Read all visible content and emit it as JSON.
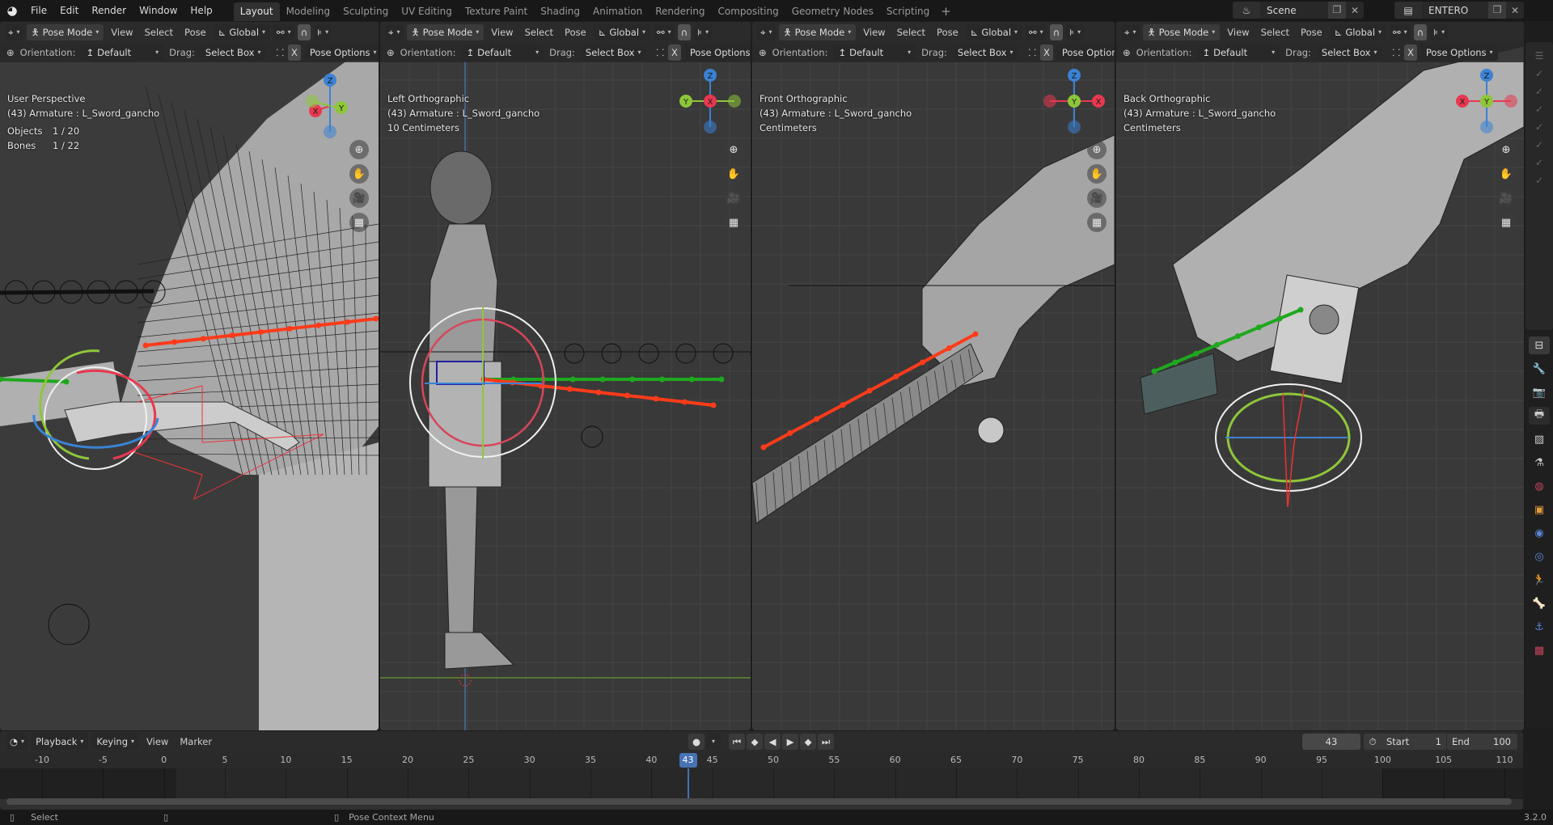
{
  "app": {
    "menu": [
      "File",
      "Edit",
      "Render",
      "Window",
      "Help"
    ],
    "workspaces": [
      "Layout",
      "Modeling",
      "Sculpting",
      "UV Editing",
      "Texture Paint",
      "Shading",
      "Animation",
      "Rendering",
      "Compositing",
      "Geometry Nodes",
      "Scripting"
    ],
    "active_workspace": "Layout",
    "add_workspace": "+",
    "scene": "Scene",
    "view_layer": "ENTERO",
    "version": "3.2.0"
  },
  "viewport_header": {
    "mode": "Pose Mode",
    "menus": [
      "View",
      "Select",
      "Pose"
    ],
    "transform_orientation": "Global",
    "orientation_label": "Orientation:",
    "orientation_value": "Default",
    "drag_label": "Drag:",
    "drag_value": "Select Box",
    "x_mirror": "X",
    "pose_options": "Pose Options"
  },
  "viewports": [
    {
      "view": "User Perspective",
      "object": "(43) Armature : L_Sword_gancho",
      "objects_label": "Objects",
      "objects_value": "1 / 20",
      "bones_label": "Bones",
      "bones_value": "1 / 22"
    },
    {
      "view": "Left Orthographic",
      "object": "(43) Armature : L_Sword_gancho",
      "scale": "10 Centimeters"
    },
    {
      "view": "Front Orthographic",
      "object": "(43) Armature : L_Sword_gancho",
      "scale": "Centimeters"
    },
    {
      "view": "Back Orthographic",
      "object": "(43) Armature : L_Sword_gancho",
      "scale": "Centimeters"
    }
  ],
  "gizmo_labels": {
    "x": "X",
    "y": "Y",
    "z": "Z"
  },
  "timeline": {
    "menus": [
      "Playback",
      "Keying",
      "View",
      "Marker"
    ],
    "current_frame": "43",
    "start_label": "Start",
    "start_value": "1",
    "end_label": "End",
    "end_value": "100",
    "ticks": [
      "-10",
      "-5",
      "0",
      "5",
      "10",
      "15",
      "20",
      "25",
      "30",
      "35",
      "40",
      "45",
      "50",
      "55",
      "60",
      "65",
      "70",
      "75",
      "80",
      "85",
      "90",
      "95",
      "100",
      "105",
      "110"
    ]
  },
  "status": {
    "left_click": "Select",
    "right_click": "Pose Context Menu"
  },
  "colors": {
    "axis_x": "#e8384f",
    "axis_y": "#8ec63a",
    "axis_z": "#3b82d4",
    "playhead": "#4772b3",
    "bone_red": "#ff3b1a",
    "bone_green": "#1fa81f"
  }
}
